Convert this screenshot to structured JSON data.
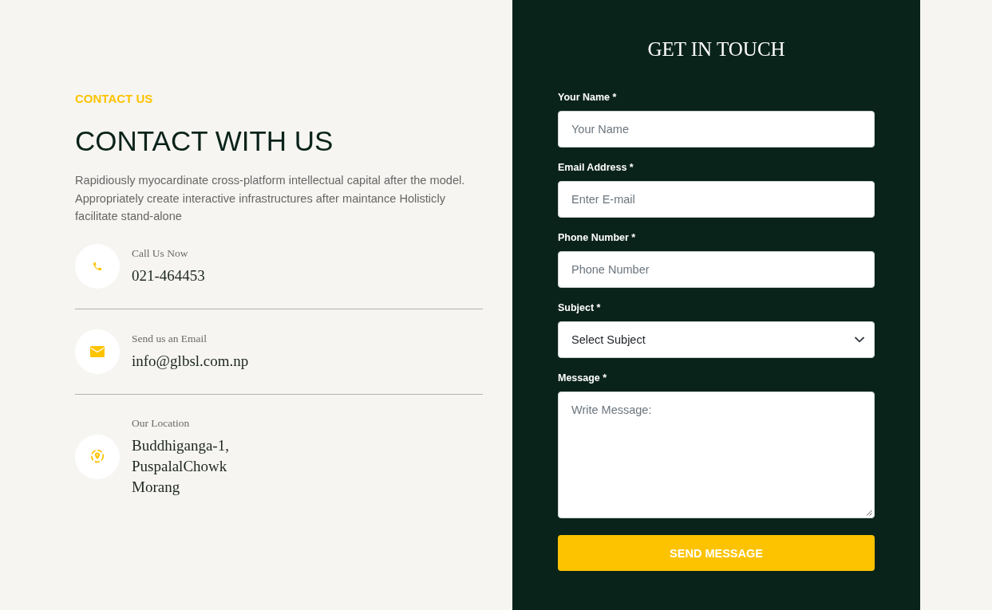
{
  "contact_info": {
    "eyebrow": "CONTACT US",
    "heading": "CONTACT WITH US",
    "description": "Rapidiously myocardinate cross-platform intellectual capital after the model. Appropriately create interactive infrastructures after maintance Holisticly facilitate stand-alone",
    "items": [
      {
        "kind": "phone",
        "label": "Call Us Now",
        "lines": [
          "021-464453"
        ]
      },
      {
        "kind": "email",
        "label": "Send us an Email",
        "lines": [
          "info@glbsl.com.np"
        ]
      },
      {
        "kind": "location",
        "label": "Our Location",
        "lines": [
          "Buddhiganga-1,",
          "PuspalalChowk",
          "Morang"
        ]
      }
    ]
  },
  "form": {
    "title": "GET IN TOUCH",
    "fields": [
      {
        "kind": "input",
        "label": "Your Name *",
        "placeholder": "Your Name"
      },
      {
        "kind": "input",
        "label": "Email Address *",
        "placeholder": "Enter E-mail"
      },
      {
        "kind": "input",
        "label": "Phone Number *",
        "placeholder": "Phone Number"
      },
      {
        "kind": "select",
        "label": "Subject *",
        "value": "Select Subject"
      },
      {
        "kind": "textarea",
        "label": "Message *",
        "placeholder": "Write Message:"
      }
    ],
    "submit": "SEND MESSAGE"
  }
}
